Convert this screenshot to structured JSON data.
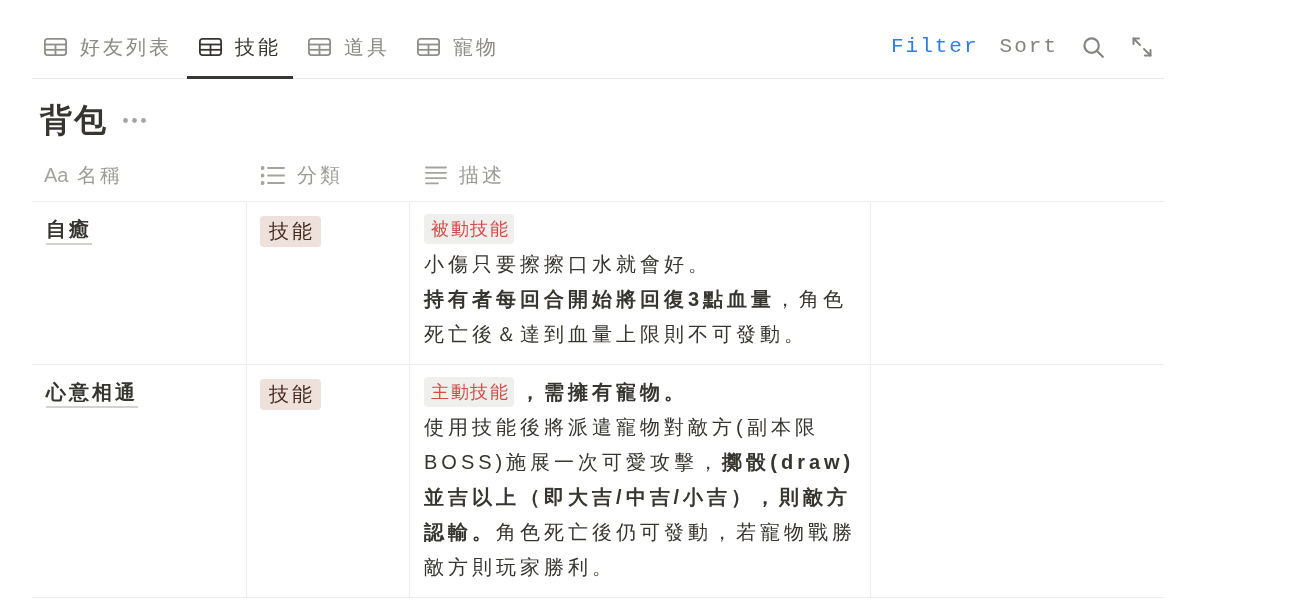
{
  "tabs": [
    {
      "label": "好友列表",
      "selected": false
    },
    {
      "label": "技能",
      "selected": true
    },
    {
      "label": "道具",
      "selected": false
    },
    {
      "label": "寵物",
      "selected": false
    }
  ],
  "toolbar": {
    "filter": {
      "label": "Filter",
      "active": true
    },
    "sort": {
      "label": "Sort",
      "active": false
    }
  },
  "database": {
    "title": "背包"
  },
  "table": {
    "columns": [
      {
        "label": "名稱",
        "kind": "title",
        "glyph": "Aa"
      },
      {
        "label": "分類",
        "kind": "select"
      },
      {
        "label": "描述",
        "kind": "text"
      }
    ],
    "rows": [
      {
        "name": "自癒",
        "category": "技能",
        "description": {
          "tag": "被動技能",
          "paragraphs": [
            "小傷只要擦擦口水就會好。",
            "**持有者每回合開始將回復3點血量**，角色死亡後＆達到血量上限則不可發動。"
          ]
        }
      },
      {
        "name": "心意相通",
        "category": "技能",
        "description": {
          "tag": "主動技能",
          "note": "，需擁有寵物。",
          "paragraphs": [
            "使用技能後將派遣寵物對敵方(副本限BOSS)施展一次可愛攻擊，**擲骰(draw)並吉以上（即大吉/中吉/小吉），則敵方認輸。**角色死亡後仍可發動，若寵物戰勝敵方則玩家勝利。"
          ]
        }
      }
    ]
  }
}
